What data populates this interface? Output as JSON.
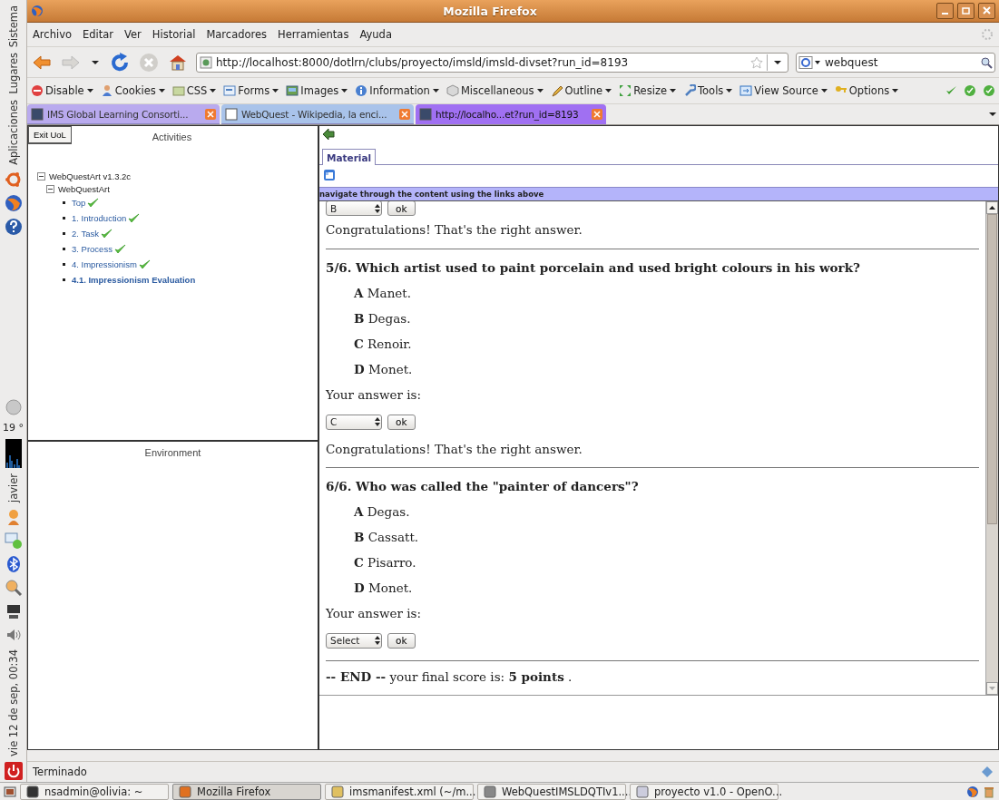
{
  "left_panel": {
    "menus": [
      "Sistema",
      "Lugares",
      "Aplicaciones"
    ],
    "temperature": "19 °",
    "user": "javier",
    "clock": "vie 12 de sep, 00:34"
  },
  "window": {
    "title": "Mozilla Firefox"
  },
  "menu_bar": [
    "Archivo",
    "Editar",
    "Ver",
    "Historial",
    "Marcadores",
    "Herramientas",
    "Ayuda"
  ],
  "navigation": {
    "url": "http://localhost:8000/dotlrn/clubs/proyecto/imsld/imsld-divset?run_id=8193",
    "search": "webquest"
  },
  "developer_toolbar": [
    "Disable",
    "Cookies",
    "CSS",
    "Forms",
    "Images",
    "Information",
    "Miscellaneous",
    "Outline",
    "Resize",
    "Tools",
    "View Source",
    "Options"
  ],
  "tabs": [
    {
      "label": "IMS Global Learning Consorti...",
      "selected": false,
      "color": "#b9aaee"
    },
    {
      "label": "WebQuest - Wikipedia, la enci...",
      "selected": false,
      "color": "#a9c3ea"
    },
    {
      "label": "http://localho...et?run_id=8193",
      "selected": true,
      "color": "#a070f2"
    }
  ],
  "activities": {
    "exit_button": "Exit UoL",
    "title": "Activities",
    "tree": [
      {
        "label": "WebQuestArt v1.3.2c",
        "expanded": true,
        "children": [
          {
            "label": "WebQuestArt",
            "expanded": true,
            "children": [
              {
                "label": "Top",
                "done": true,
                "selected": false
              },
              {
                "label": "1. Introduction",
                "done": true,
                "selected": false
              },
              {
                "label": "2. Task",
                "done": true,
                "selected": false
              },
              {
                "label": "3. Process",
                "done": true,
                "selected": false
              },
              {
                "label": "4. Impressionism",
                "done": true,
                "selected": false
              },
              {
                "label": "4.1. Impressionism Evaluation",
                "done": false,
                "selected": true
              }
            ]
          }
        ]
      }
    ]
  },
  "environment": {
    "title": "Environment"
  },
  "material": {
    "tab": {
      "label": "Material",
      "selected": true
    },
    "hint": "navigate through the content using the links above",
    "top_answer": {
      "select": "B",
      "button": "ok"
    },
    "top_feedback": "Congratulations! That's the right answer.",
    "questions": [
      {
        "title": "5/6. Which artist used to paint porcelain and used bright colours in his work?",
        "options": [
          {
            "letter": "A",
            "text": "Manet."
          },
          {
            "letter": "B",
            "text": "Degas."
          },
          {
            "letter": "C",
            "text": "Renoir."
          },
          {
            "letter": "D",
            "text": "Monet."
          }
        ],
        "prompt": "Your answer is:",
        "select": "C",
        "button": "ok",
        "feedback": "Congratulations! That's the right answer."
      },
      {
        "title": "6/6. Who was called the \"painter of dancers\"?",
        "options": [
          {
            "letter": "A",
            "text": "Degas."
          },
          {
            "letter": "B",
            "text": "Cassatt."
          },
          {
            "letter": "C",
            "text": "Pisarro."
          },
          {
            "letter": "D",
            "text": "Monet."
          }
        ],
        "prompt": "Your answer is:",
        "select": "Select",
        "button": "ok"
      }
    ],
    "final": "**-- END --** your final score is: **5 points** ."
  },
  "status_bar": "Terminado",
  "taskbar": [
    {
      "label": "nsadmin@olivia: ~",
      "selected": false
    },
    {
      "label": "Mozilla Firefox",
      "selected": true
    },
    {
      "label": "imsmanifest.xml (~/m...",
      "selected": false
    },
    {
      "label": "WebQuestIMSLDQTIv1....",
      "selected": false
    },
    {
      "label": "proyecto v1.0 - OpenO...",
      "selected": false
    }
  ]
}
